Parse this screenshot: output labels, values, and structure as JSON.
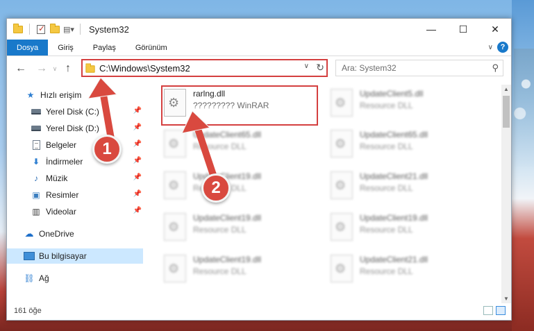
{
  "window": {
    "title": "System32",
    "controls": {
      "minimize": "—",
      "maximize": "☐",
      "close": "✕"
    }
  },
  "ribbon": {
    "tabs": [
      {
        "label": "Dosya",
        "active": true
      },
      {
        "label": "Giriş"
      },
      {
        "label": "Paylaş"
      },
      {
        "label": "Görünüm"
      }
    ],
    "help": "?"
  },
  "nav": {
    "back": "←",
    "forward": "→",
    "up": "↑",
    "address": "C:\\Windows\\System32",
    "search_placeholder": "Ara: System32"
  },
  "sidebar": {
    "items": [
      {
        "label": "Hızlı erişim",
        "icon": "star-icon"
      },
      {
        "label": "Yerel Disk (C:)",
        "icon": "drive-icon",
        "pinned": true
      },
      {
        "label": "Yerel Disk (D:)",
        "icon": "drive-icon",
        "pinned": true
      },
      {
        "label": "Belgeler",
        "icon": "documents-icon",
        "pinned": true
      },
      {
        "label": "İndirmeler",
        "icon": "download-icon",
        "pinned": true
      },
      {
        "label": "Müzik",
        "icon": "music-icon",
        "pinned": true
      },
      {
        "label": "Resimler",
        "icon": "pictures-icon",
        "pinned": true
      },
      {
        "label": "Videolar",
        "icon": "video-icon",
        "pinned": true
      },
      {
        "label": "OneDrive",
        "icon": "cloud-icon"
      },
      {
        "label": "Bu bilgisayar",
        "icon": "computer-icon",
        "selected": true
      },
      {
        "label": "Ağ",
        "icon": "network-icon"
      }
    ]
  },
  "files": [
    {
      "name": "rarlng.dll",
      "type": "????????? WinRAR",
      "highlighted": true
    },
    {
      "name": "UpdateClient5.dll",
      "type": "Resource DLL"
    },
    {
      "name": "UpdateClient65.dll",
      "type": "Resource DLL"
    },
    {
      "name": "UpdateClient65.dll",
      "type": "Resource DLL"
    },
    {
      "name": "UpdateClient19.dll",
      "type": "Resource DLL"
    },
    {
      "name": "UpdateClient21.dll",
      "type": "Resource DLL"
    },
    {
      "name": "UpdateClient19.dll",
      "type": "Resource DLL"
    },
    {
      "name": "UpdateClient19.dll",
      "type": "Resource DLL"
    },
    {
      "name": "UpdateClient19.dll",
      "type": "Resource DLL"
    },
    {
      "name": "UpdateClient21.dll",
      "type": "Resource DLL"
    }
  ],
  "status": {
    "count": "161 öğe"
  },
  "annotations": {
    "badge1": "1",
    "badge2": "2",
    "highlight_color": "#d43f3f"
  }
}
